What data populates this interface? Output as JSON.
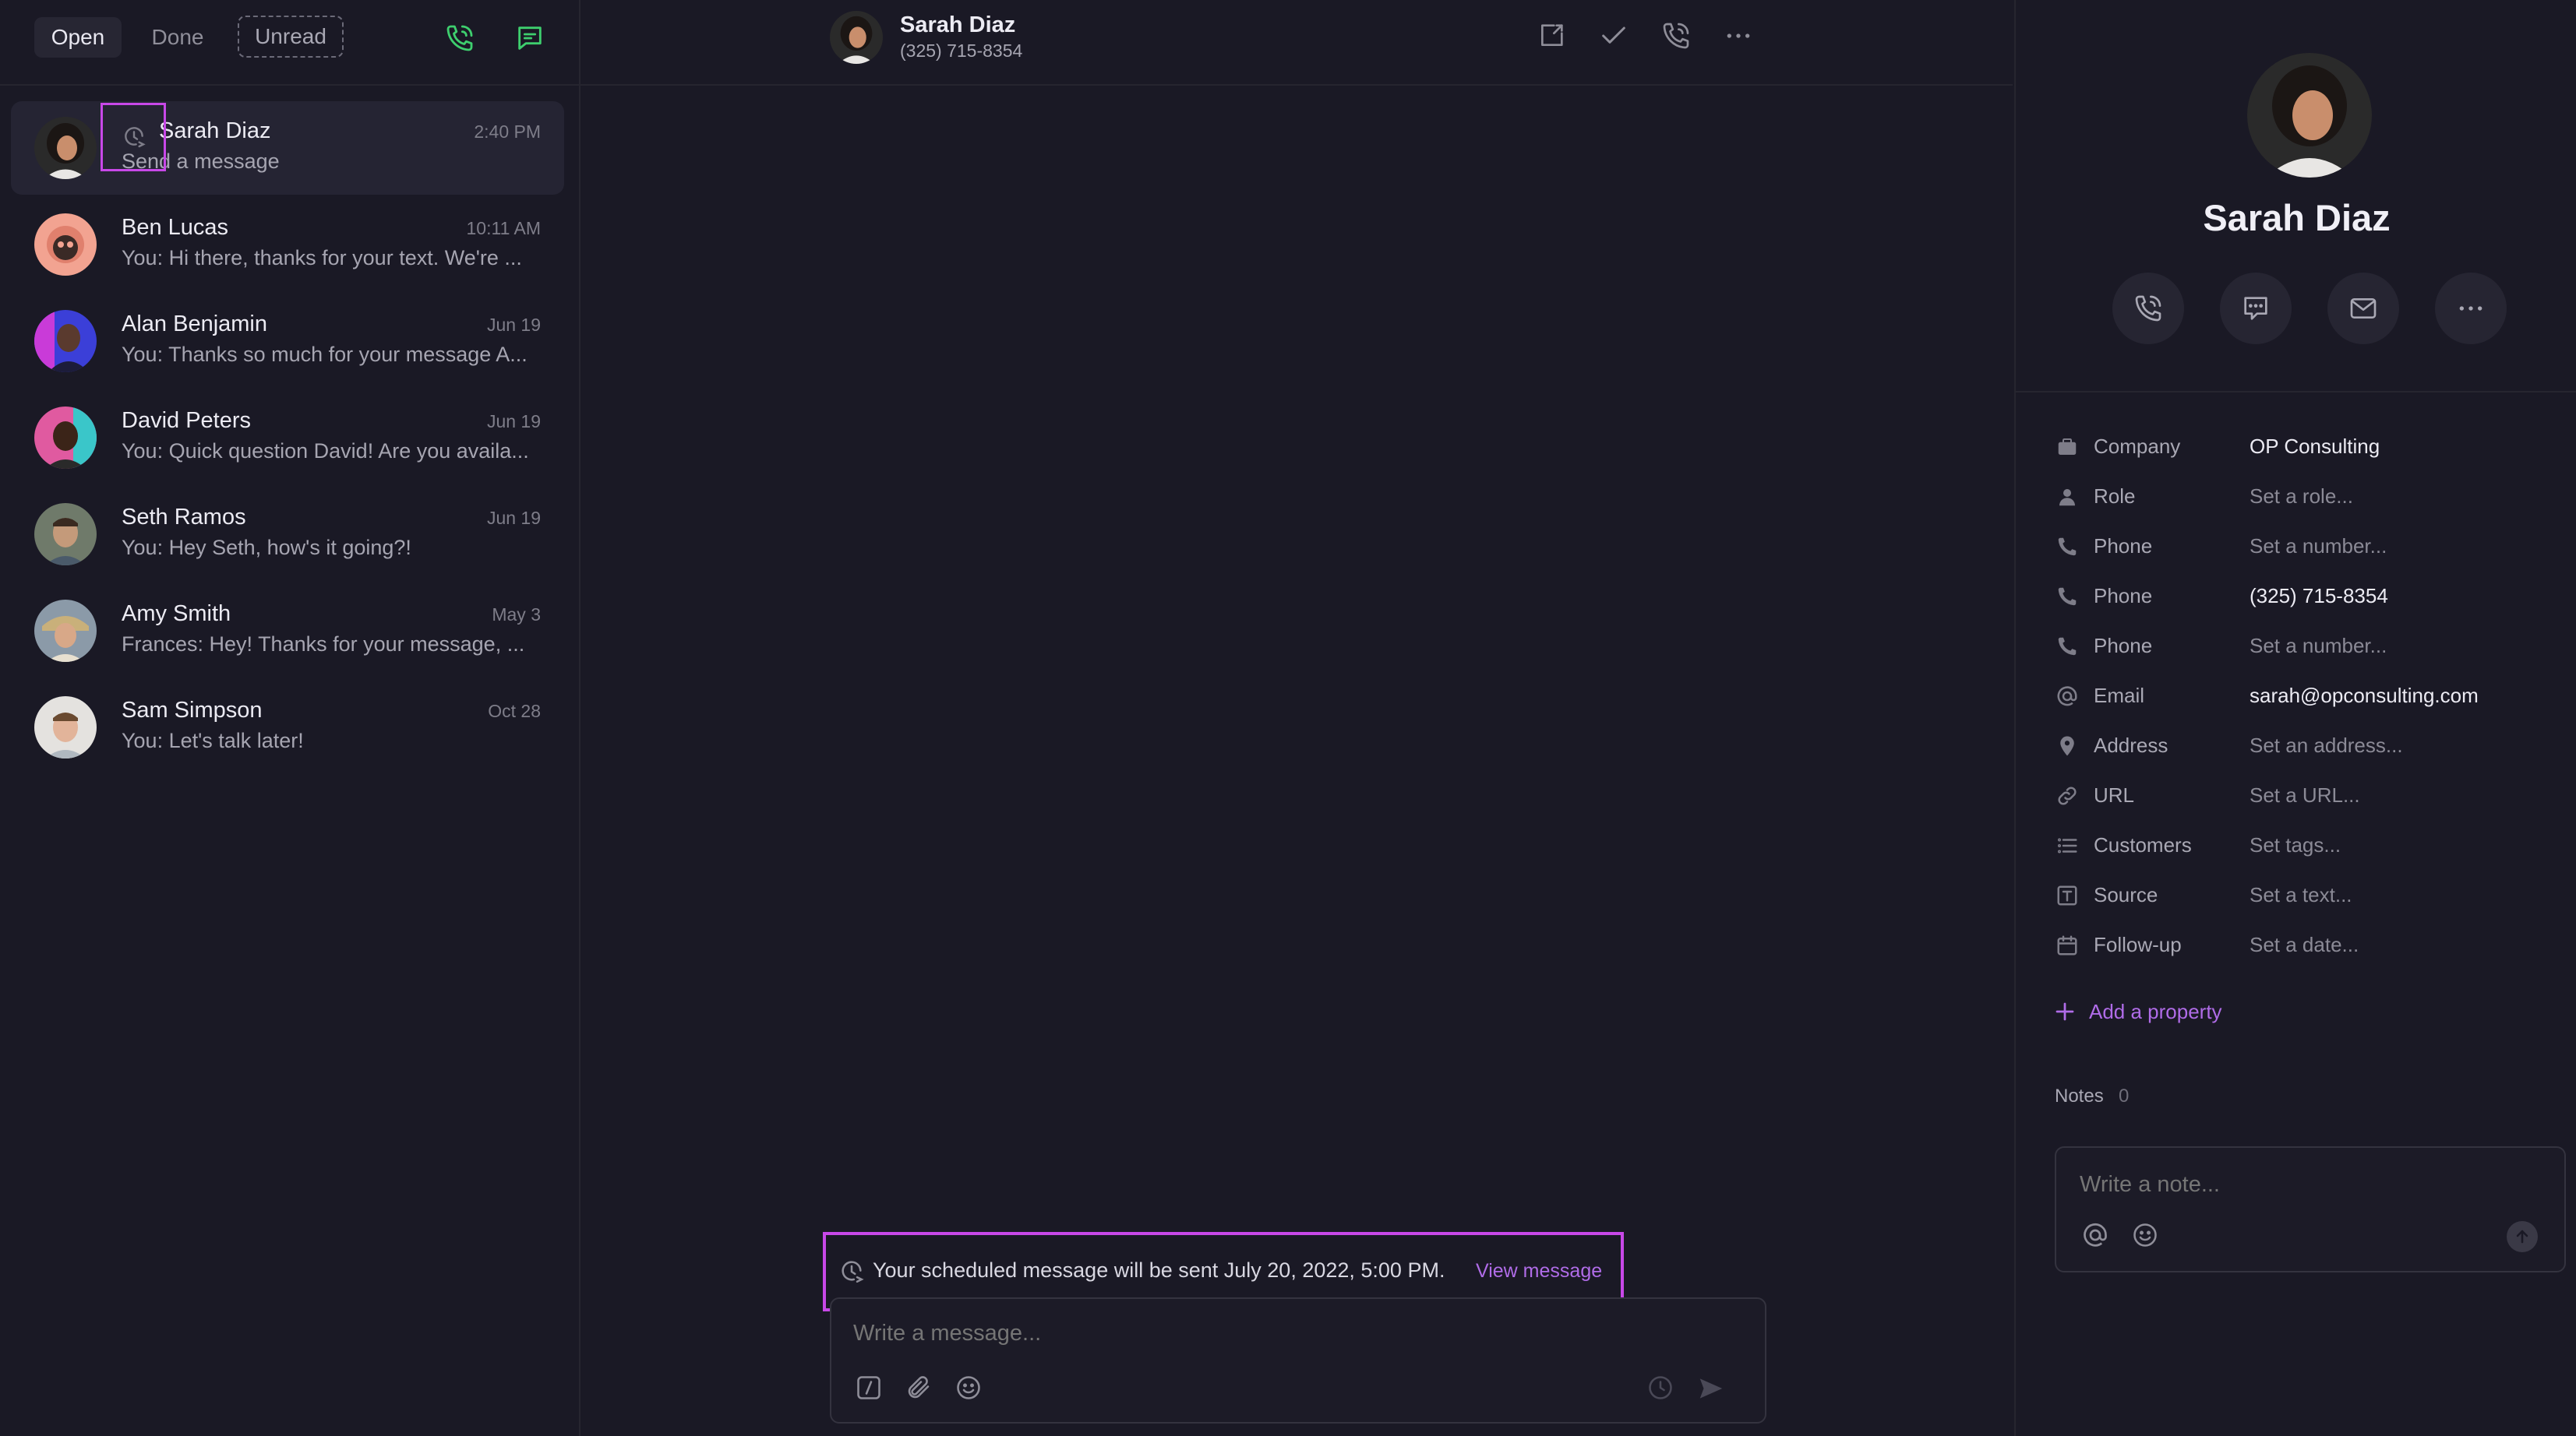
{
  "colors": {
    "background": "#1a1925",
    "accent_purple": "#b06ce8",
    "accent_green": "#3ecf6e",
    "highlight_box": "#c848e8"
  },
  "left_header": {
    "tabs": [
      "Open",
      "Done",
      "Unread"
    ],
    "icons": [
      "phone-icon",
      "new-message-icon"
    ]
  },
  "conversations": [
    {
      "name": "Sarah Diaz",
      "time": "2:40 PM",
      "preview": "Send a message",
      "scheduled_icon": "clock-send-icon",
      "selected": true
    },
    {
      "name": "Ben Lucas",
      "time": "10:11 AM",
      "preview": "You: Hi there, thanks for your text. We're ..."
    },
    {
      "name": "Alan Benjamin",
      "time": "Jun 19",
      "preview": "You: Thanks so much for your message A..."
    },
    {
      "name": "David Peters",
      "time": "Jun 19",
      "preview": "You: Quick question David! Are you availa..."
    },
    {
      "name": "Seth Ramos",
      "time": "Jun 19",
      "preview": "You: Hey Seth, how's it going?!"
    },
    {
      "name": "Amy Smith",
      "time": "May 3",
      "preview": "Frances: Hey! Thanks for your message, ..."
    },
    {
      "name": "Sam Simpson",
      "time": "Oct 28",
      "preview": "You: Let's talk later!"
    }
  ],
  "chat_header": {
    "name": "Sarah Diaz",
    "phone": "(325) 715-8354",
    "actions": [
      "open-in-new-icon",
      "check-icon",
      "phone-icon",
      "more-icon"
    ]
  },
  "scheduled_banner": {
    "text": "Your scheduled message will be sent July 20, 2022, 5:00 PM.",
    "link": "View message"
  },
  "composer": {
    "placeholder": "Write a message..."
  },
  "contact": {
    "name": "Sarah Diaz",
    "actions": [
      "phone-icon",
      "message-icon",
      "mail-icon",
      "more-icon"
    ],
    "properties": [
      {
        "icon": "company-icon",
        "label": "Company",
        "value": "OP Consulting",
        "filled": true
      },
      {
        "icon": "person-icon",
        "label": "Role",
        "value": "Set a role...",
        "filled": false
      },
      {
        "icon": "phone-icon",
        "label": "Phone",
        "value": "Set a number...",
        "filled": false
      },
      {
        "icon": "phone-icon",
        "label": "Phone",
        "value": "(325) 715-8354",
        "filled": true
      },
      {
        "icon": "phone-icon",
        "label": "Phone",
        "value": "Set a number...",
        "filled": false
      },
      {
        "icon": "at-icon",
        "label": "Email",
        "value": "sarah@opconsulting.com",
        "filled": true
      },
      {
        "icon": "location-icon",
        "label": "Address",
        "value": "Set an address...",
        "filled": false
      },
      {
        "icon": "link-icon",
        "label": "URL",
        "value": "Set a URL...",
        "filled": false
      },
      {
        "icon": "list-icon",
        "label": "Customers",
        "value": "Set tags...",
        "filled": false
      },
      {
        "icon": "text-box-icon",
        "label": "Source",
        "value": "Set a text...",
        "filled": false
      },
      {
        "icon": "calendar-icon",
        "label": "Follow-up",
        "value": "Set a date...",
        "filled": false
      }
    ],
    "add_property": "Add a property",
    "notes_label": "Notes",
    "notes_count": "0",
    "note_placeholder": "Write a note..."
  }
}
